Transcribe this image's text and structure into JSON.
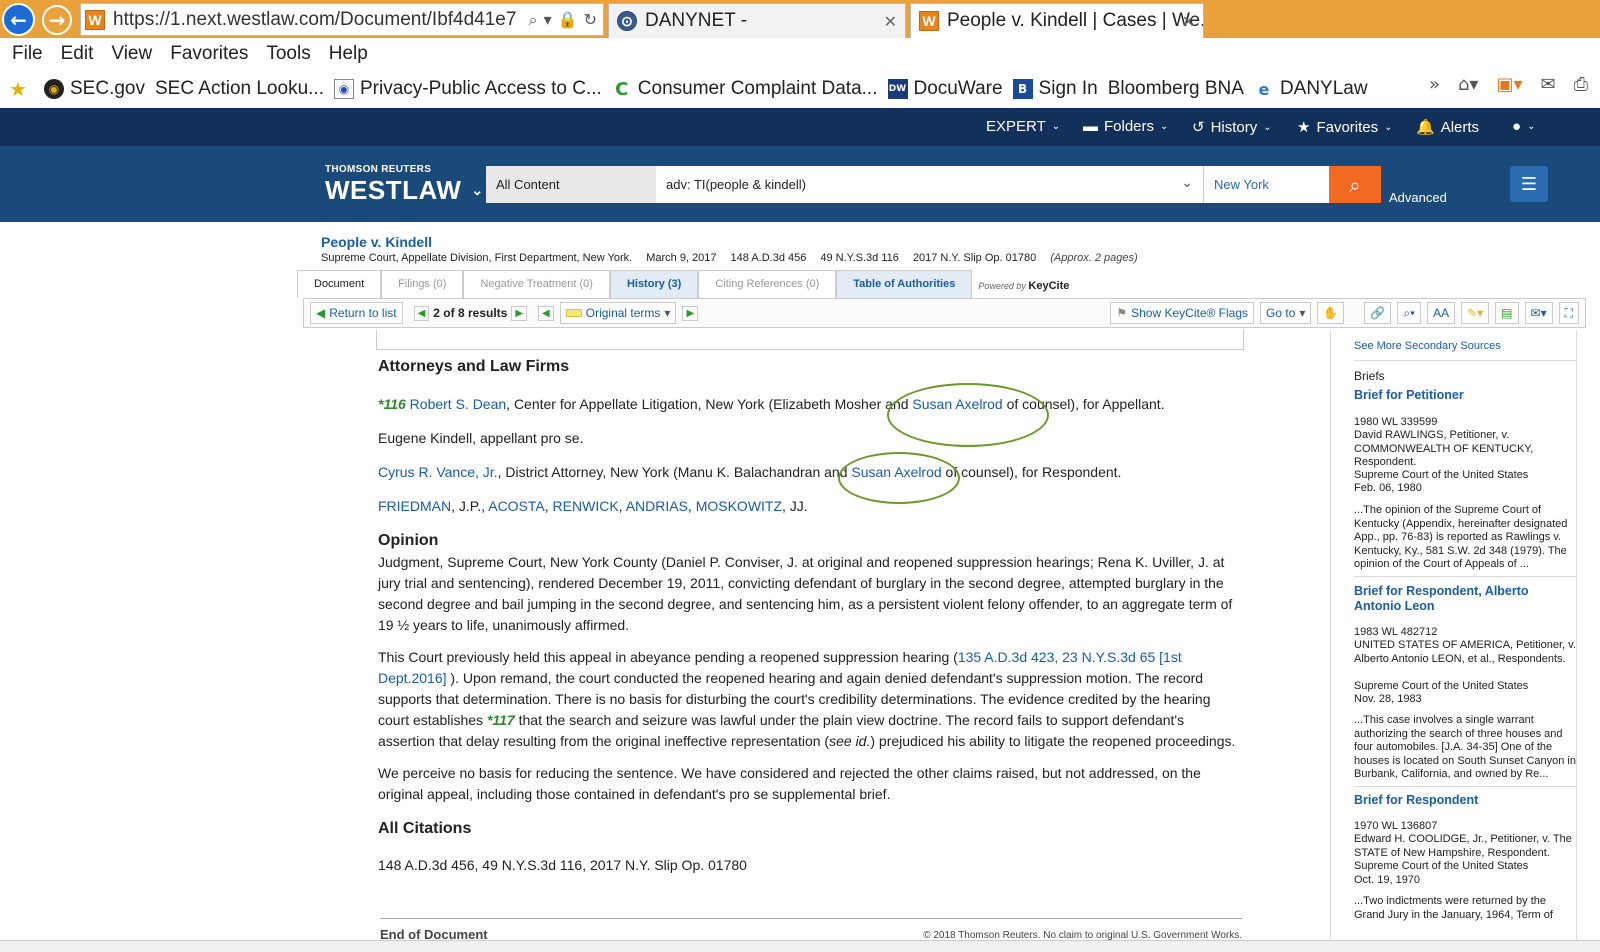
{
  "browser": {
    "url": "https://1.next.westlaw.com/Document/Ibf4d41e7",
    "tabs": [
      {
        "label": "DANYNET -"
      },
      {
        "label": "People v. Kindell | Cases | We..."
      }
    ],
    "menu": [
      "File",
      "Edit",
      "View",
      "Favorites",
      "Tools",
      "Help"
    ],
    "favorites": [
      "SEC.gov",
      "SEC Action Looku...",
      "Privacy-Public Access to C...",
      "Consumer Complaint Data...",
      "DocuWare",
      "Sign In",
      "Bloomberg BNA",
      "DANYLaw"
    ]
  },
  "westlaw": {
    "topnav": {
      "expert": "EXPERT",
      "folders": "Folders",
      "history": "History",
      "favorites": "Favorites",
      "alerts": "Alerts"
    },
    "brand_small": "THOMSON REUTERS",
    "brand": "WESTLAW",
    "search": {
      "category": "All Content",
      "query": "adv: TI(people & kindell)",
      "jurisdiction": "New York",
      "advanced": "Advanced"
    }
  },
  "doc": {
    "title": "People v. Kindell",
    "meta": [
      "Supreme Court, Appellate Division, First Department, New York.",
      "March 9, 2017",
      "148 A.D.3d 456",
      "49 N.Y.S.3d 116",
      "2017 N.Y. Slip Op. 01780"
    ],
    "approx": "(Approx. 2 pages)",
    "tabs": [
      "Document",
      "Filings (0)",
      "Negative Treatment (0)",
      "History (3)",
      "Citing References (0)",
      "Table of Authorities"
    ],
    "powered": "Powered by",
    "keycite": "KeyCite",
    "toolbar": {
      "return": "Return to list",
      "results": "2 of 8 results",
      "terms": "Original terms",
      "flags": "Show KeyCite® Flags",
      "goto": "Go to"
    }
  },
  "body": {
    "attorneys_heading": "Attorneys and Law Firms",
    "p1": {
      "star": "*116",
      "name": "Robert S. Dean",
      "mid": ", Center for Appellate Litigation, New York (Elizabeth Mosher and ",
      "name2": "Susan Axelrod",
      "end": " of counsel), for Appellant."
    },
    "p2": "Eugene Kindell, appellant pro se.",
    "p3": {
      "name": "Cyrus R. Vance, Jr.",
      "mid": ", District Attorney, New York (Manu K. Balachandran and ",
      "name2": "Susan Axelrod",
      "end": " of counsel), for Respondent."
    },
    "p4": {
      "j1": "FRIEDMAN",
      "t1": ", J.P., ",
      "j2": "ACOSTA",
      "j3": "RENWICK",
      "j4": "ANDRIAS",
      "j5": "MOSKOWITZ",
      "t2": ", JJ."
    },
    "opinion_heading": "Opinion",
    "op1": "Judgment, Supreme Court, New York County (Daniel P. Conviser, J. at original and reopened suppression hearings; Rena K. Uviller, J. at jury trial and sentencing), rendered December 19, 2011, convicting defendant of burglary in the second degree, attempted burglary in the second degree and bail jumping in the second degree, and sentencing him, as a persistent violent felony offender, to an aggregate term of 19 ½ years to life, unanimously affirmed.",
    "op2": {
      "a": "This Court previously held this appeal in abeyance pending a reopened suppression hearing (",
      "cite": "135 A.D.3d 423, 23 N.Y.S.3d 65 [1st Dept.2016]",
      "b": " ). Upon remand, the court conducted the reopened hearing and again denied defendant's suppression motion. The record supports that determination. There is no basis for disturbing the court's credibility determinations. The evidence credited by the hearing court establishes ",
      "star": "*117",
      "c": " that the search and seizure was lawful under the plain view doctrine. The record fails to support defendant's assertion that delay resulting from the original ineffective representation (",
      "see": "see id.",
      "d": ") prejudiced his ability to litigate the reopened proceedings."
    },
    "op3": "We perceive no basis for reducing the sentence. We have considered and rejected the other claims raised, but not addressed, on the original appeal, including those contained in defendant's pro se supplemental brief.",
    "citations_heading": "All Citations",
    "citations": "148 A.D.3d 456, 49 N.Y.S.3d 116, 2017 N.Y. Slip Op. 01780",
    "end": "End of Document",
    "copyright": "© 2018 Thomson Reuters. No claim to original U.S. Government Works."
  },
  "sidebar": {
    "more": "See More Secondary Sources",
    "briefs": "Briefs",
    "items": [
      {
        "title": "Brief for Petitioner",
        "cite": "1980 WL 339599",
        "parties": "David RAWLINGS, Petitioner, v. COMMONWEALTH OF KENTUCKY, Respondent.",
        "court": "Supreme Court of the United States",
        "date": "Feb. 06, 1980",
        "snippet": "...The opinion of the Supreme Court of Kentucky (Appendix, hereinafter designated App., pp. 76-83) is reported as Rawlings v. Kentucky, Ky., 581 S.W. 2d 348 (1979). The opinion of the Court of Appeals of ..."
      },
      {
        "title": "Brief for Respondent, Alberto Antonio Leon",
        "cite": "1983 WL 482712",
        "parties": "UNITED STATES OF AMERICA, Petitioner, v. Alberto Antonio LEON, et al., Respondents.",
        "court": "Supreme Court of the United States",
        "date": "Nov. 28, 1983",
        "snippet": "...This case involves a single warrant authorizing the search of three houses and four automobiles. [J.A. 34-35] One of the houses is located on South Sunset Canyon in Burbank, California, and owned by Re..."
      },
      {
        "title": "Brief for Respondent",
        "cite": "1970 WL 136807",
        "parties": "Edward H. COOLIDGE, Jr., Petitioner, v. The STATE of New Hampshire, Respondent.",
        "court": "Supreme Court of the United States",
        "date": "Oct. 19, 1970",
        "snippet": "...Two indictments were returned by the Grand Jury in the January, 1964, Term of"
      }
    ]
  }
}
